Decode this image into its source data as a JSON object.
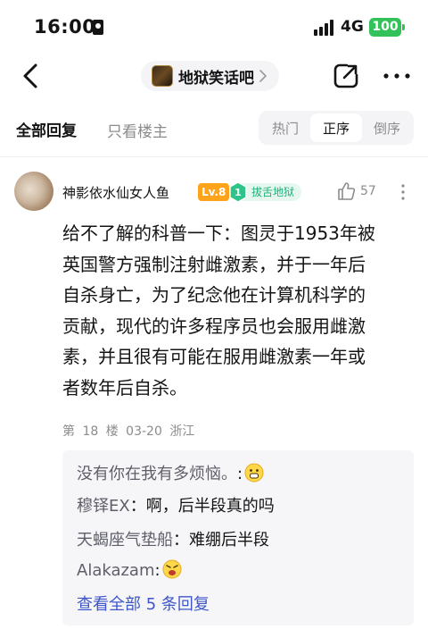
{
  "status_bar": {
    "time": "16:00",
    "network": "4G",
    "battery": "100"
  },
  "nav": {
    "forum_name": "地狱笑话吧"
  },
  "tabs": {
    "all_replies": "全部回复",
    "only_op": "只看楼主",
    "sort_options": [
      "热门",
      "正序",
      "倒序"
    ],
    "active_sort": "正序"
  },
  "post": {
    "username": "神影依水仙女人鱼",
    "level": "Lv.8",
    "badge": "拔舌地狱",
    "likes": "57",
    "body": "给不了解的科普一下：图灵于1953年被\n英国警方强制注射雌激素，并于一年后\n自杀身亡，为了纪念他在计算机科学的\n贡献，现代的许多程序员也会服用雌激\n素，并且很有可能在服用雌激素一年或\n者数年后自杀。",
    "floor": "第 18 楼",
    "date": "03-20",
    "location": "浙江"
  },
  "replies": [
    {
      "who": "没有你在我有多烦恼。",
      "sep": ":",
      "text": "",
      "emoji": "shocked-emoji"
    },
    {
      "who": "穆铎EX",
      "sep": "：",
      "text": "啊，后半段真的吗",
      "emoji": ""
    },
    {
      "who": "天蝎座气垫船",
      "sep": "：",
      "text": "难绷后半段",
      "emoji": ""
    },
    {
      "who": "Alakazam",
      "sep": ":",
      "text": "",
      "emoji": "scared-emoji"
    }
  ],
  "view_all": "查看全部 5 条回复",
  "colors": {
    "level_badge": "#ffa31a",
    "title_badge": "#1fb37a",
    "link": "#3d56c9",
    "battery": "#33c15a"
  }
}
